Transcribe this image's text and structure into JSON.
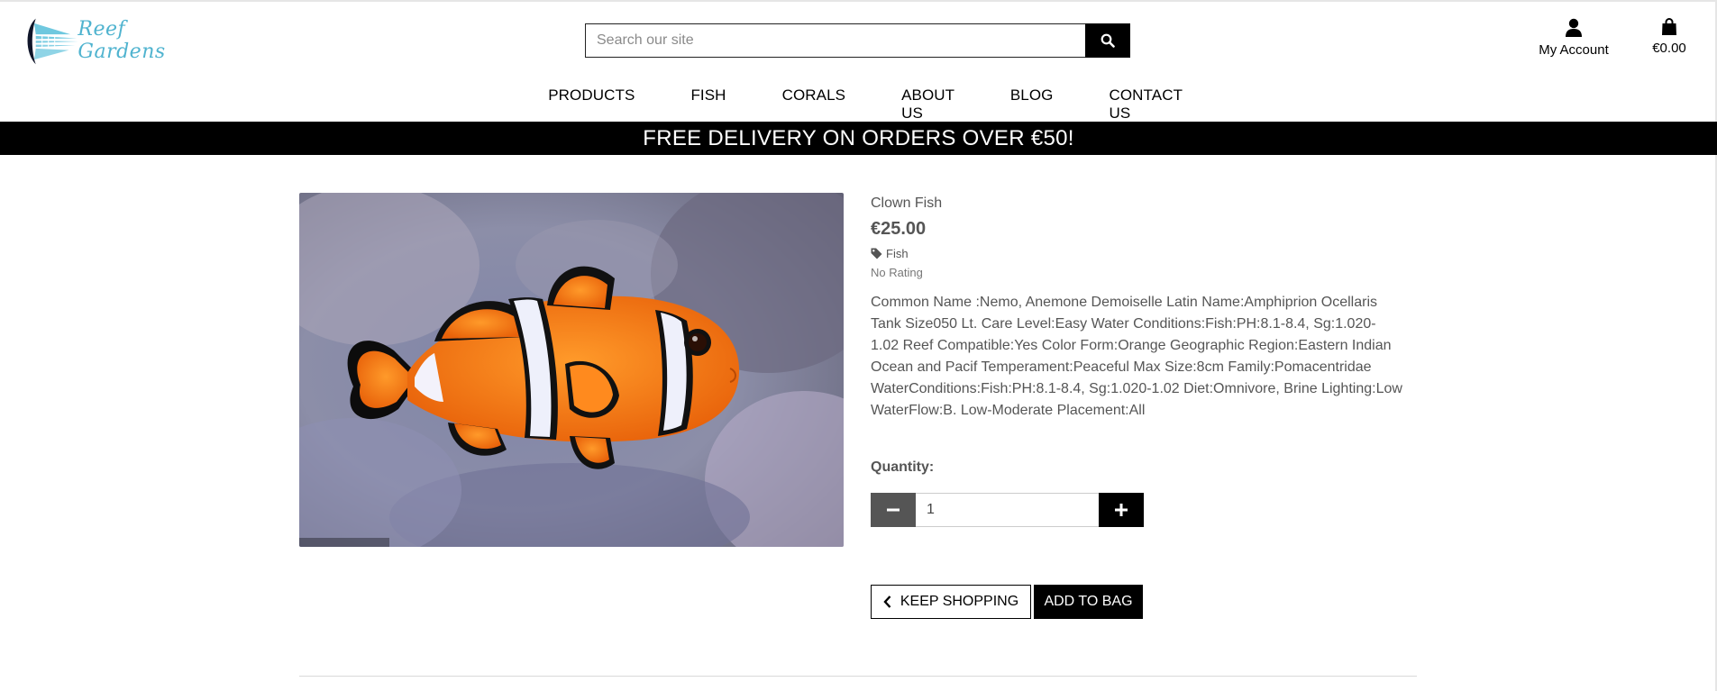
{
  "header": {
    "brand": "Reef Gardens",
    "search_placeholder": "Search our site",
    "account_label": "My Account",
    "bag_total": "€0.00"
  },
  "nav": {
    "items": [
      {
        "label": "PRODUCTS"
      },
      {
        "label": "FISH"
      },
      {
        "label": "CORALS"
      },
      {
        "label": "ABOUT US"
      },
      {
        "label": "BLOG"
      },
      {
        "label": "CONTACT US"
      }
    ]
  },
  "banner": {
    "text": "FREE DELIVERY ON ORDERS OVER €50!"
  },
  "product": {
    "name": "Clown Fish",
    "price": "€25.00",
    "category": "Fish",
    "rating": "No Rating",
    "description": "Common Name :Nemo, Anemone Demoiselle Latin Name:Amphiprion Ocellaris Tank Size050 Lt. Care Level:Easy Water Conditions:Fish:PH:8.1-8.4, Sg:1.020-1.02 Reef Compatible:Yes Color Form:Orange Geographic Region:Eastern Indian Ocean and Pacif Temperament:Peaceful Max Size:8cm Family:Pomacentridae WaterConditions:Fish:PH:8.1-8.4, Sg:1.020-1.02 Diet:Omnivore, Brine Lighting:Low WaterFlow:B. Low-Moderate Placement:All",
    "quantity_label": "Quantity:",
    "quantity_value": "1",
    "keep_shopping_label": "KEEP SHOPPING",
    "add_to_bag_label": "ADD TO BAG"
  },
  "icons": {
    "search": "search-icon",
    "account": "user-icon",
    "bag": "shopping-bag-icon",
    "tag": "tag-icon",
    "minus": "minus-icon",
    "plus": "plus-icon",
    "chevron": "chevron-left-icon"
  },
  "colors": {
    "brand": "#4fb3cf",
    "banner_bg": "#000000",
    "text": "#555555",
    "minus_button": "#555555",
    "plus_button": "#000000"
  }
}
